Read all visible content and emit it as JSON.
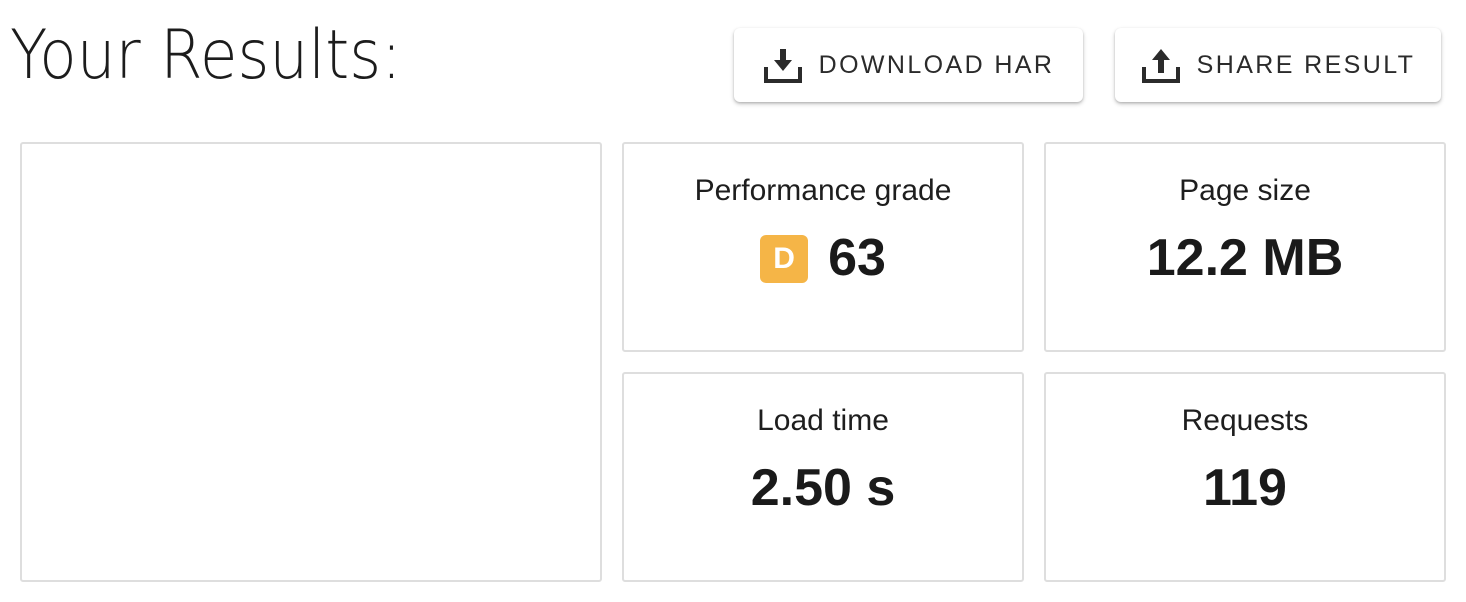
{
  "header": {
    "title": "Your Results:"
  },
  "actions": {
    "download_label": "DOWNLOAD HAR",
    "share_label": "SHARE RESULT"
  },
  "metrics": {
    "performance": {
      "label": "Performance grade",
      "grade_letter": "D",
      "grade_color": "#f5b547",
      "value": "63"
    },
    "page_size": {
      "label": "Page size",
      "value": "12.2 MB"
    },
    "load_time": {
      "label": "Load time",
      "value": "2.50 s"
    },
    "requests": {
      "label": "Requests",
      "value": "119"
    }
  },
  "icons": {
    "download": "download-icon",
    "share": "share-icon"
  }
}
